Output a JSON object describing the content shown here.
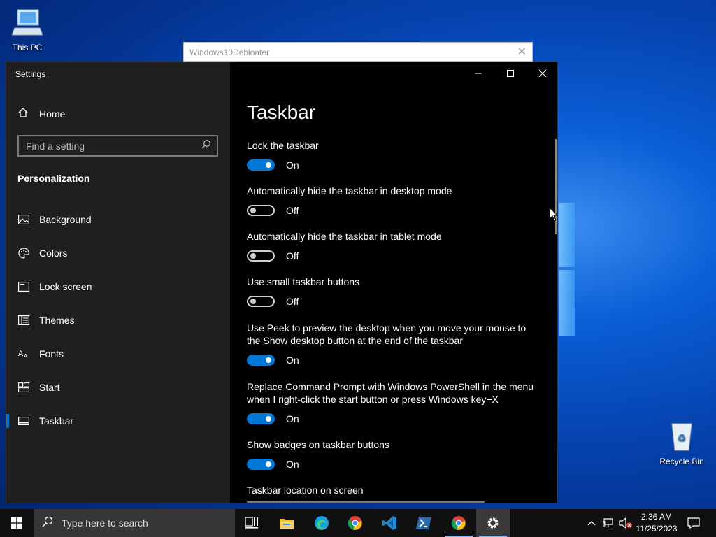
{
  "desktop": {
    "icons": [
      {
        "label": "This PC"
      },
      {
        "label": "Recycle Bin"
      }
    ]
  },
  "background_window": {
    "title": "Windows10Debloater"
  },
  "window": {
    "title": "Settings",
    "controls": {
      "minimize": "—",
      "maximize": "☐",
      "close": "✕"
    }
  },
  "sidebar": {
    "home_label": "Home",
    "search_placeholder": "Find a setting",
    "section": "Personalization",
    "items": [
      {
        "label": "Background",
        "icon": "background-icon"
      },
      {
        "label": "Colors",
        "icon": "palette-icon"
      },
      {
        "label": "Lock screen",
        "icon": "lock-screen-icon"
      },
      {
        "label": "Themes",
        "icon": "themes-icon"
      },
      {
        "label": "Fonts",
        "icon": "fonts-icon"
      },
      {
        "label": "Start",
        "icon": "start-icon"
      },
      {
        "label": "Taskbar",
        "icon": "taskbar-icon",
        "selected": true
      }
    ]
  },
  "content": {
    "title": "Taskbar",
    "settings": [
      {
        "label": "Lock the taskbar",
        "state": "On"
      },
      {
        "label": "Automatically hide the taskbar in desktop mode",
        "state": "Off"
      },
      {
        "label": "Automatically hide the taskbar in tablet mode",
        "state": "Off"
      },
      {
        "label": "Use small taskbar buttons",
        "state": "Off"
      },
      {
        "label": "Use Peek to preview the desktop when you move your mouse to the Show desktop button at the end of the taskbar",
        "state": "On"
      },
      {
        "label": "Replace Command Prompt with Windows PowerShell in the menu when I right-click the start button or press Windows key+X",
        "state": "On"
      },
      {
        "label": "Show badges on taskbar buttons",
        "state": "On"
      }
    ],
    "location_label": "Taskbar location on screen"
  },
  "taskbar": {
    "search_placeholder": "Type here to search",
    "clock": {
      "time": "2:36 AM",
      "date": "11/25/2023"
    },
    "accent": "#0078d7"
  }
}
